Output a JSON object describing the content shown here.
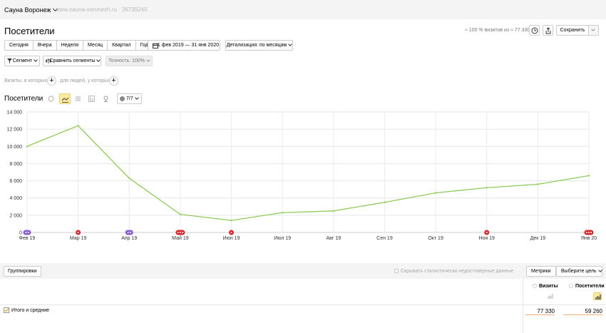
{
  "header": {
    "counter_name": "Сауна Воронеж",
    "counter_meta": "www.sauna-voronezh.ru · 36739240"
  },
  "page": {
    "title": "Посетители",
    "sample_info": "≈ 100 % визитов из ≈ 77 330",
    "save_label": "Сохранить"
  },
  "period": {
    "buttons": [
      "Сегодня",
      "Вчера",
      "Неделя",
      "Месяц",
      "Квартал",
      "Год"
    ],
    "date_range": "1 фев 2019 — 31 янв 2020",
    "detail": "Детализация: по месяцам"
  },
  "segments": {
    "segment_label": "Сегмент",
    "compare_label": "Сравнить сегменты",
    "accuracy": "Точность: 100%"
  },
  "filters": {
    "visits_hint": "Визиты, в которых",
    "people_hint": "для людей, у которых"
  },
  "chart_panel": {
    "title": "Посетители",
    "metric_count": "7/7"
  },
  "chart_data": {
    "type": "line",
    "title": "Посетители",
    "categories": [
      "Фев 19",
      "Мар 19",
      "Апр 19",
      "Май 19",
      "Июн 19",
      "Июл 19",
      "Авг 19",
      "Сен 19",
      "Окт 19",
      "Ноя 19",
      "Дек 19",
      "Янв 20"
    ],
    "series": [
      {
        "values": [
          10000,
          12400,
          6300,
          2100,
          1400,
          2300,
          2500,
          3500,
          4600,
          5200,
          5600,
          6600
        ]
      }
    ],
    "ylim": [
      0,
      14000
    ],
    "yticks": [
      0,
      2000,
      4000,
      6000,
      8000,
      10000,
      12000,
      14000
    ],
    "ytick_labels": [
      "0",
      "2 000",
      "4 000",
      "6 000",
      "8 000",
      "10 000",
      "12 000",
      "14 000"
    ],
    "grid": true,
    "line_color": "#8fcc5a",
    "annotations": [
      {
        "category": 0,
        "type": "purple",
        "count": 2
      },
      {
        "category": 1,
        "type": "red",
        "count": 1
      },
      {
        "category": 2,
        "type": "purple",
        "count": 2
      },
      {
        "category": 3,
        "type": "red",
        "count": 3
      },
      {
        "category": 4,
        "type": "red",
        "count": 1
      },
      {
        "category": 9,
        "type": "red",
        "count": 1
      },
      {
        "category": 11,
        "type": "red",
        "count": 3
      }
    ]
  },
  "table": {
    "groupings_label": "Группировки",
    "hide_unreliable": "Скрывать статистически недостоверные данные",
    "metrics_label": "Метрики",
    "goal_label": "Выберите цель",
    "columns": [
      "Визиты",
      "Посетители"
    ],
    "total_label": "Итого и средние",
    "totals": [
      "77 330",
      "59 260"
    ]
  },
  "colors": {
    "accent": "#ffeba0",
    "bar": "#f0b070",
    "mark_red": "#d8262b",
    "mark_purple": "#8a5cd6"
  }
}
